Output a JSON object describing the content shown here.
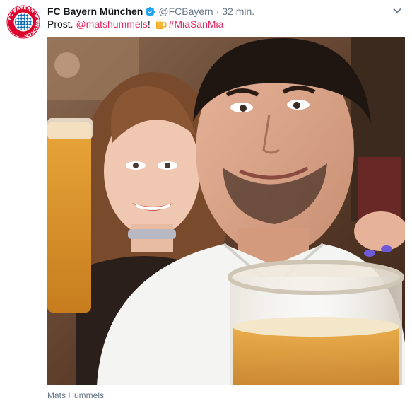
{
  "account": {
    "name": "FC Bayern München",
    "handle": "@FCBayern",
    "separator": "·",
    "time": "32 min.",
    "verified": true,
    "avatar_icon": "fc-bayern-logo",
    "avatar_logo_text": "FC BAYERN MÜNCHEN"
  },
  "tweet": {
    "text_prefix": "Prost. ",
    "mention": "@matshummels",
    "text_mid": "! ",
    "emoji": "beer-mug-icon",
    "hashtag": "#MiaSanMia"
  },
  "media": {
    "caption": "Mats Hummels",
    "alt": "Selfie of a couple holding beer mugs at Oktoberfest"
  },
  "colors": {
    "link": "#e0245e",
    "secondary_text": "#657786",
    "verified_blue": "#1da1f2",
    "bayern_red": "#dc052d",
    "bayern_blue": "#0066b2"
  }
}
